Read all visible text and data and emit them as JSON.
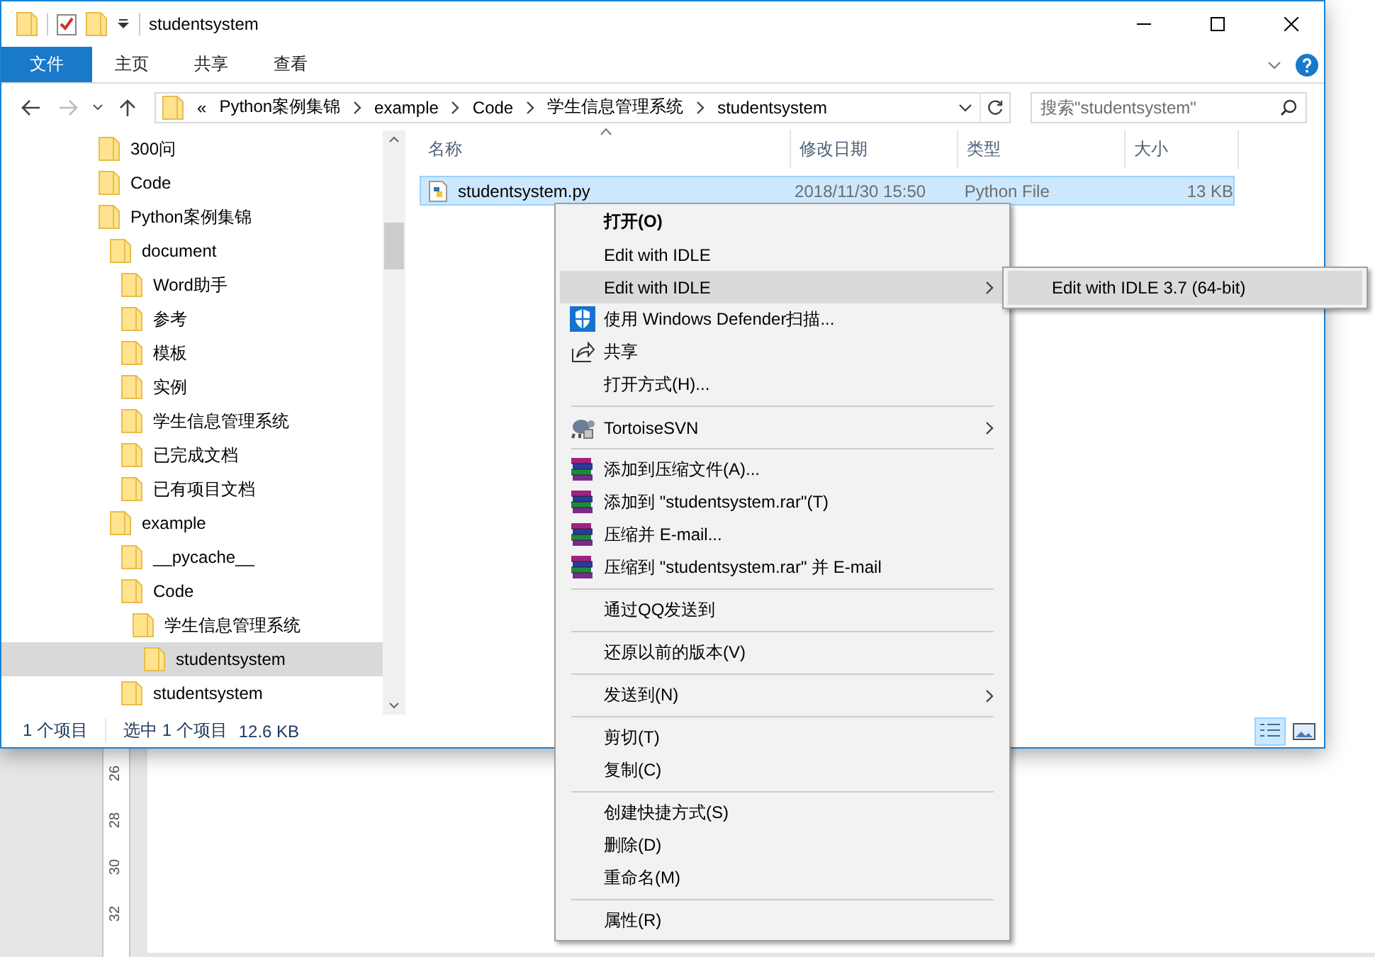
{
  "window": {
    "title": "studentsystem"
  },
  "ribbon_tabs": [
    {
      "label": "文件",
      "kind": "file"
    },
    {
      "label": "主页",
      "kind": "tab"
    },
    {
      "label": "共享",
      "kind": "tab"
    },
    {
      "label": "查看",
      "kind": "tab"
    }
  ],
  "address": {
    "prefix": "«",
    "crumbs": [
      "Python案例集锦",
      "example",
      "Code",
      "学生信息管理系统",
      "studentsystem"
    ]
  },
  "search": {
    "placeholder": "搜索\"studentsystem\""
  },
  "tree": [
    {
      "label": "300问",
      "selected": false
    },
    {
      "label": "Code",
      "selected": false
    },
    {
      "label": "Python案例集锦",
      "selected": false,
      "children": [
        {
          "label": "document",
          "selected": false,
          "children": [
            {
              "label": "Word助手",
              "selected": false
            },
            {
              "label": "参考",
              "selected": false
            },
            {
              "label": "模板",
              "selected": false
            },
            {
              "label": "实例",
              "selected": false
            },
            {
              "label": "学生信息管理系统",
              "selected": false
            },
            {
              "label": "已完成文档",
              "selected": false
            },
            {
              "label": "已有项目文档",
              "selected": false
            }
          ]
        },
        {
          "label": "example",
          "selected": false,
          "children": [
            {
              "label": "__pycache__",
              "selected": false
            },
            {
              "label": "Code",
              "selected": false,
              "children": [
                {
                  "label": "学生信息管理系统",
                  "selected": false,
                  "children": [
                    {
                      "label": "studentsystem",
                      "selected": true
                    }
                  ]
                }
              ]
            },
            {
              "label": "studentsystem",
              "selected": false
            }
          ]
        }
      ]
    }
  ],
  "columns": [
    {
      "label": "名称",
      "sorted": true
    },
    {
      "label": "修改日期",
      "sorted": false
    },
    {
      "label": "类型",
      "sorted": false
    },
    {
      "label": "大小",
      "sorted": false
    }
  ],
  "files": [
    {
      "name": "studentsystem.py",
      "modified": "2018/11/30 15:50",
      "type": "Python File",
      "size": "13 KB",
      "selected": true
    }
  ],
  "status_bar": {
    "count": "1 个项目",
    "selection": "选中 1 个项目",
    "size": "12.6 KB",
    "views": [
      {
        "kind": "details",
        "selected": true
      },
      {
        "kind": "large-icons",
        "selected": false
      }
    ]
  },
  "context_menu": [
    {
      "kind": "text",
      "label": "打开(O)",
      "default": true,
      "selected": false,
      "has_submenu": false
    },
    {
      "kind": "text",
      "label": "Edit with IDLE",
      "default": false,
      "selected": false,
      "has_submenu": false
    },
    {
      "kind": "text",
      "label": "Edit with IDLE",
      "default": false,
      "selected": true,
      "has_submenu": true
    },
    {
      "kind": "defender",
      "label": "使用 Windows Defender扫描...",
      "default": false,
      "selected": false,
      "has_submenu": false
    },
    {
      "kind": "share",
      "label": "共享",
      "default": false,
      "selected": false,
      "has_submenu": false
    },
    {
      "kind": "text",
      "label": "打开方式(H)...",
      "default": false,
      "selected": false,
      "has_submenu": false
    },
    {
      "kind": "separator"
    },
    {
      "kind": "svn",
      "label": "TortoiseSVN",
      "default": false,
      "selected": false,
      "has_submenu": true
    },
    {
      "kind": "separator"
    },
    {
      "kind": "archive",
      "label": "添加到压缩文件(A)...",
      "default": false,
      "selected": false,
      "has_submenu": false
    },
    {
      "kind": "archive",
      "label": "添加到 \"studentsystem.rar\"(T)",
      "default": false,
      "selected": false,
      "has_submenu": false
    },
    {
      "kind": "archive",
      "label": "压缩并 E-mail...",
      "default": false,
      "selected": false,
      "has_submenu": false
    },
    {
      "kind": "archive",
      "label": "压缩到 \"studentsystem.rar\" 并 E-mail",
      "default": false,
      "selected": false,
      "has_submenu": false
    },
    {
      "kind": "separator"
    },
    {
      "kind": "text",
      "label": "通过QQ发送到",
      "default": false,
      "selected": false,
      "has_submenu": false
    },
    {
      "kind": "separator"
    },
    {
      "kind": "text",
      "label": "还原以前的版本(V)",
      "default": false,
      "selected": false,
      "has_submenu": false
    },
    {
      "kind": "separator"
    },
    {
      "kind": "text",
      "label": "发送到(N)",
      "default": false,
      "selected": false,
      "has_submenu": true
    },
    {
      "kind": "separator"
    },
    {
      "kind": "text",
      "label": "剪切(T)",
      "default": false,
      "selected": false,
      "has_submenu": false
    },
    {
      "kind": "text",
      "label": "复制(C)",
      "default": false,
      "selected": false,
      "has_submenu": false
    },
    {
      "kind": "separator"
    },
    {
      "kind": "text",
      "label": "创建快捷方式(S)",
      "default": false,
      "selected": false,
      "has_submenu": false
    },
    {
      "kind": "text",
      "label": "删除(D)",
      "default": false,
      "selected": false,
      "has_submenu": false
    },
    {
      "kind": "text",
      "label": "重命名(M)",
      "default": false,
      "selected": false,
      "has_submenu": false
    },
    {
      "kind": "separator"
    },
    {
      "kind": "text",
      "label": "属性(R)",
      "default": false,
      "selected": false,
      "has_submenu": false
    }
  ],
  "submenu": [
    {
      "label": "Edit with IDLE 3.7 (64-bit)",
      "selected": true
    }
  ],
  "ruler_numbers": [
    "26",
    "28",
    "30",
    "32"
  ]
}
